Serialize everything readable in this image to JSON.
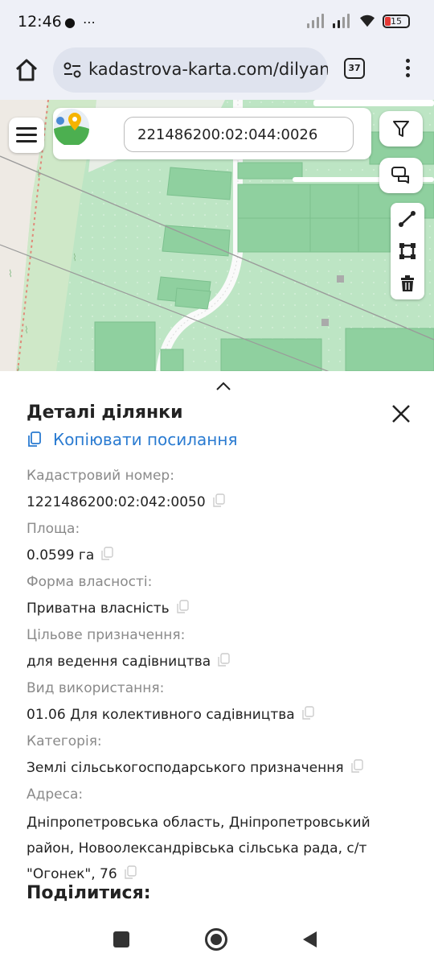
{
  "status_bar": {
    "time": "12:46",
    "left_icons": "● ⋯",
    "battery": "15"
  },
  "browser": {
    "url": "kadastrova-karta.com/dilyanka",
    "tab_count": "37"
  },
  "map": {
    "search_value": "221486200:02:044:0026",
    "tool_icons": [
      "ruler-icon",
      "polygon-icon",
      "trash-icon"
    ]
  },
  "panel": {
    "title": "Деталі ділянки",
    "copy_link": "Копіювати посилання",
    "fields": [
      {
        "label": "Кадастровий номер:",
        "value": "1221486200:02:042:0050"
      },
      {
        "label": "Площа:",
        "value": "0.0599 га"
      },
      {
        "label": "Форма власності:",
        "value": "Приватна власність"
      },
      {
        "label": "Цільове призначення:",
        "value": "для ведення садівництва"
      },
      {
        "label": "Вид використання:",
        "value": "01.06 Для колективного садівництва"
      },
      {
        "label": "Категорія:",
        "value": "Землі сільськогосподарського призначення"
      },
      {
        "label": "Адреса:",
        "value": "Дніпропетровська область, Дніпропетровський район, Новоолександрівська сільська рада, с/т \"Огонек\", 76"
      }
    ],
    "share_title": "Поділитися:"
  },
  "colors": {
    "accent": "#2a7bd1",
    "map_green": "#b9e3c0",
    "parcel": "#8fd09f"
  }
}
